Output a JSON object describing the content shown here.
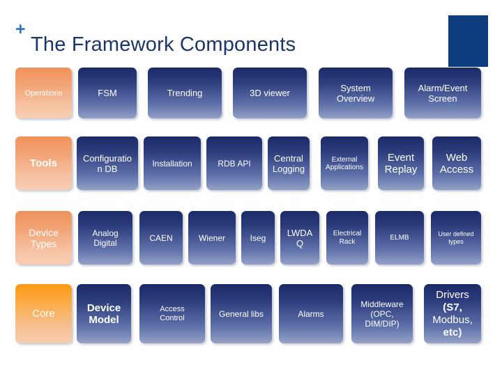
{
  "slide": {
    "title": "The Framework Components",
    "bullet_marker": "+",
    "colors": {
      "title": "#1a3668",
      "bullet": "#3576c4",
      "corner_block": "#0d3c7e",
      "box_navy_top": "#1b2a67",
      "box_navy_bottom": "#93a1c6",
      "box_orange_top": "#f0925a",
      "box_orange_bottom": "#f8cdb2",
      "box_orange_strong_top": "#fb9a14",
      "text": "#ffffff"
    }
  },
  "rows": [
    {
      "name": "operations",
      "category": "Operations",
      "items": [
        {
          "label": "FSM"
        },
        {
          "label": "Trending"
        },
        {
          "label": "3D viewer"
        },
        {
          "label": "System Overview"
        },
        {
          "label": "Alarm/Event Screen"
        }
      ]
    },
    {
      "name": "tools",
      "category": "Tools",
      "items": [
        {
          "label": "Configuration DB"
        },
        {
          "label": "Installation"
        },
        {
          "label": "RDB API"
        },
        {
          "label": "Central Logging"
        },
        {
          "label": "External Applications"
        },
        {
          "label": "Event Replay"
        },
        {
          "label": "Web Access"
        }
      ]
    },
    {
      "name": "device-types",
      "category": "Device Types",
      "items": [
        {
          "label": "Analog Digital"
        },
        {
          "label": "CAEN"
        },
        {
          "label": "Wiener"
        },
        {
          "label": "Iseg"
        },
        {
          "label": "LWDA Q"
        },
        {
          "label": "Electrical Rack"
        },
        {
          "label": "ELMB"
        },
        {
          "label": "User defined types"
        }
      ]
    },
    {
      "name": "core",
      "category": "Core",
      "items": [
        {
          "label": "Device Model"
        },
        {
          "label": "Access Control"
        },
        {
          "label": "General libs"
        },
        {
          "label": "Alarms"
        },
        {
          "label": "Middleware (OPC, DIM/DIP)"
        },
        {
          "label": "Drivers (S7, Modbus, etc)"
        }
      ]
    }
  ],
  "drivers_parts": {
    "line1": "Drivers",
    "line2": "(S7,",
    "line3": "Modbus,",
    "line4": "etc)"
  }
}
